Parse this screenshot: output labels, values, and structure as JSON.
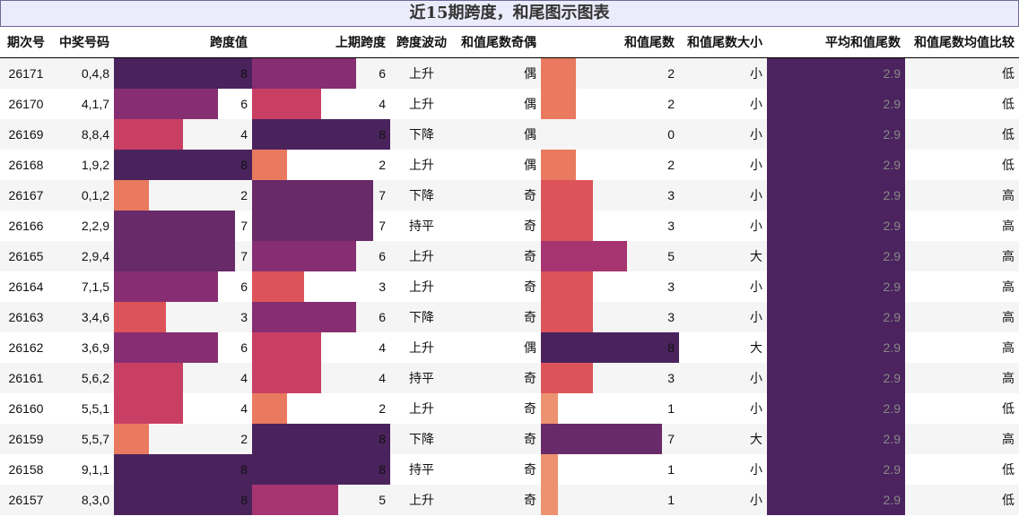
{
  "title": "近15期跨度，和尾图示图表",
  "chart_data": {
    "type": "table",
    "columns": [
      "期次号",
      "中奖号码",
      "跨度值",
      "上期跨度",
      "跨度波动",
      "和值尾数奇偶",
      "和值尾数",
      "和值尾数大小",
      "平均和值尾数",
      "和值尾数均值比较"
    ],
    "rows": [
      {
        "issue": "26171",
        "numbers": "0,4,8",
        "span": 8,
        "prev_span": 6,
        "trend": "上升",
        "parity": "偶",
        "tail": 2,
        "size": "小",
        "avg": "2.9",
        "cmp": "低"
      },
      {
        "issue": "26170",
        "numbers": "4,1,7",
        "span": 6,
        "prev_span": 4,
        "trend": "上升",
        "parity": "偶",
        "tail": 2,
        "size": "小",
        "avg": "2.9",
        "cmp": "低"
      },
      {
        "issue": "26169",
        "numbers": "8,8,4",
        "span": 4,
        "prev_span": 8,
        "trend": "下降",
        "parity": "偶",
        "tail": 0,
        "size": "小",
        "avg": "2.9",
        "cmp": "低"
      },
      {
        "issue": "26168",
        "numbers": "1,9,2",
        "span": 8,
        "prev_span": 2,
        "trend": "上升",
        "parity": "偶",
        "tail": 2,
        "size": "小",
        "avg": "2.9",
        "cmp": "低"
      },
      {
        "issue": "26167",
        "numbers": "0,1,2",
        "span": 2,
        "prev_span": 7,
        "trend": "下降",
        "parity": "奇",
        "tail": 3,
        "size": "小",
        "avg": "2.9",
        "cmp": "高"
      },
      {
        "issue": "26166",
        "numbers": "2,2,9",
        "span": 7,
        "prev_span": 7,
        "trend": "持平",
        "parity": "奇",
        "tail": 3,
        "size": "小",
        "avg": "2.9",
        "cmp": "高"
      },
      {
        "issue": "26165",
        "numbers": "2,9,4",
        "span": 7,
        "prev_span": 6,
        "trend": "上升",
        "parity": "奇",
        "tail": 5,
        "size": "大",
        "avg": "2.9",
        "cmp": "高"
      },
      {
        "issue": "26164",
        "numbers": "7,1,5",
        "span": 6,
        "prev_span": 3,
        "trend": "上升",
        "parity": "奇",
        "tail": 3,
        "size": "小",
        "avg": "2.9",
        "cmp": "高"
      },
      {
        "issue": "26163",
        "numbers": "3,4,6",
        "span": 3,
        "prev_span": 6,
        "trend": "下降",
        "parity": "奇",
        "tail": 3,
        "size": "小",
        "avg": "2.9",
        "cmp": "高"
      },
      {
        "issue": "26162",
        "numbers": "3,6,9",
        "span": 6,
        "prev_span": 4,
        "trend": "上升",
        "parity": "偶",
        "tail": 8,
        "size": "大",
        "avg": "2.9",
        "cmp": "高"
      },
      {
        "issue": "26161",
        "numbers": "5,6,2",
        "span": 4,
        "prev_span": 4,
        "trend": "持平",
        "parity": "奇",
        "tail": 3,
        "size": "小",
        "avg": "2.9",
        "cmp": "高"
      },
      {
        "issue": "26160",
        "numbers": "5,5,1",
        "span": 4,
        "prev_span": 2,
        "trend": "上升",
        "parity": "奇",
        "tail": 1,
        "size": "小",
        "avg": "2.9",
        "cmp": "低"
      },
      {
        "issue": "26159",
        "numbers": "5,5,7",
        "span": 2,
        "prev_span": 8,
        "trend": "下降",
        "parity": "奇",
        "tail": 7,
        "size": "大",
        "avg": "2.9",
        "cmp": "高"
      },
      {
        "issue": "26158",
        "numbers": "9,1,1",
        "span": 8,
        "prev_span": 8,
        "trend": "持平",
        "parity": "奇",
        "tail": 1,
        "size": "小",
        "avg": "2.9",
        "cmp": "低"
      },
      {
        "issue": "26157",
        "numbers": "8,3,0",
        "span": 8,
        "prev_span": 5,
        "trend": "上升",
        "parity": "奇",
        "tail": 1,
        "size": "小",
        "avg": "2.9",
        "cmp": "低"
      }
    ],
    "span_max": 8,
    "tail_max": 8
  },
  "colors": {
    "0": "#ffffff",
    "1": "#ed9270",
    "2": "#e97a5f",
    "3": "#dc5459",
    "4": "#c93f64",
    "5": "#a63470",
    "6": "#862e71",
    "7": "#682a68",
    "8": "#4a235d",
    "avg": "#4b235e"
  }
}
